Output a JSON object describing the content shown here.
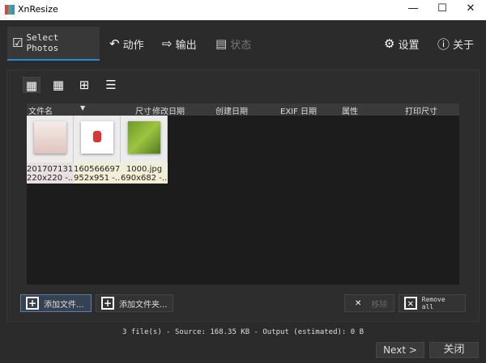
{
  "window": {
    "title": "XnResize",
    "minimize": "—",
    "maximize": "☐",
    "close": "✕"
  },
  "tabs": [
    {
      "label": "Select Photos",
      "icon": "checkbox-icon"
    },
    {
      "label": "动作",
      "icon": "undo-arrow-icon"
    },
    {
      "label": "输出",
      "icon": "export-icon"
    },
    {
      "label": "状态",
      "icon": "clipboard-icon"
    }
  ],
  "top_right": {
    "settings": "设置",
    "about": "关于"
  },
  "view_modes": [
    "small-grid-icon",
    "medium-grid-icon",
    "large-grid-icon",
    "list-view-icon"
  ],
  "columns": [
    "文件名",
    "尺寸",
    "修改日期",
    "创建日期",
    "EXIF 日期",
    "属性",
    "打印尺寸"
  ],
  "files": [
    {
      "name": "201707131...",
      "info": "220x220 -..."
    },
    {
      "name": "160566697...",
      "info": "952x951 -..."
    },
    {
      "name": "1000.jpg",
      "info": "690x682 -..."
    }
  ],
  "buttons": {
    "add_files": "添加文件...",
    "add_folder": "添加文件夹...",
    "remove": "移除",
    "remove_all": "Remove all",
    "next": "Next >",
    "close": "关闭"
  },
  "status": "3 file(s) - Source: 168.35 KB - Output (estimated): 0 B",
  "colors": {
    "accent": "#2e86d6"
  }
}
